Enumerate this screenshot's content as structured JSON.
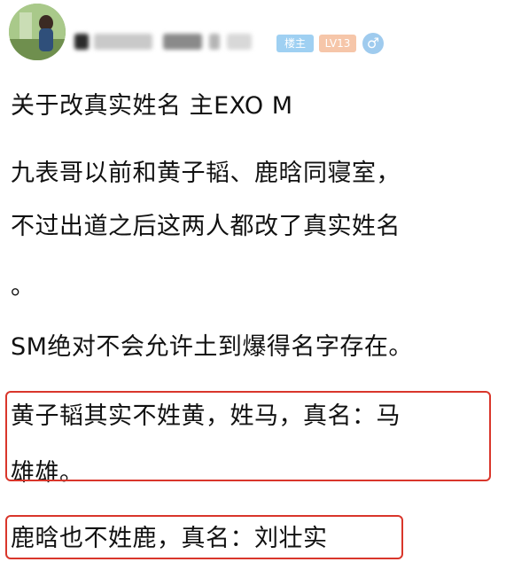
{
  "header": {
    "username_hidden": true,
    "tags": {
      "host": "楼主",
      "level": "LV13",
      "gender": "♂"
    }
  },
  "post": {
    "lines": [
      "关于改真实姓名 主EXO M",
      "九表哥以前和黄子韬、鹿晗同寝室，",
      "不过出道之后这两人都改了真实姓名",
      "。",
      "SM绝对不会允许土到爆得名字存在。",
      "黄子韬其实不姓黄，姓马，真名：马",
      "雄雄。",
      "鹿晗也不姓鹿，真名：刘壮实"
    ]
  },
  "colors": {
    "highlight_border": "#d9362b",
    "host_tag": "#9fd0f2",
    "level_tag": "#f6c6a9",
    "gender_badge": "#9fcbee",
    "text": "#111111"
  },
  "icons": {
    "avatar": "user-avatar-photo",
    "gender": "male-gender-icon"
  }
}
